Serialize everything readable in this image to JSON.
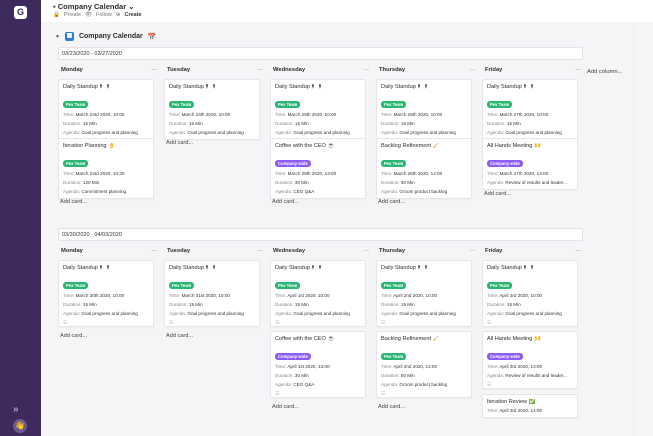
{
  "app": {
    "logo": "G",
    "title": "Company Calendar",
    "private": "Private",
    "follow": "Follow",
    "create": "Create",
    "expand": "»"
  },
  "board": {
    "title": "Company Calendar",
    "add_column": "Add column...",
    "add_card": "Add card..."
  },
  "weeks": [
    {
      "range": "03/23/2020 - 03/27/2020",
      "days": [
        {
          "name": "Monday",
          "cards": [
            {
              "title": "Daily Standup🕴🕴",
              "badge": "Pex Team",
              "badge_color": "green",
              "time": "March 23rd 2020, 10:00",
              "duration": "15 Min",
              "agenda": "Goal progress and planning"
            },
            {
              "title": "Iteration Planning 👌",
              "badge": "Pex Team",
              "badge_color": "green",
              "time": "March 23rd 2020, 10:30",
              "duration": "120 Min",
              "agenda": "Commitment planning"
            }
          ]
        },
        {
          "name": "Tuesday",
          "cards": [
            {
              "title": "Daily Standup🕴🕴",
              "badge": "Pex Team",
              "badge_color": "green",
              "time": "March 24th 2020, 10:00",
              "duration": "15 Min",
              "agenda": "Goal progress and planning"
            }
          ]
        },
        {
          "name": "Wednesday",
          "cards": [
            {
              "title": "Daily Standup🕴🕴",
              "badge": "Pex Team",
              "badge_color": "green",
              "time": "March 25th 2020, 10:00",
              "duration": "15 Min",
              "agenda": "Goal progress and planning"
            },
            {
              "title": "Coffee with the CEO ☕",
              "badge": "Company-wide",
              "badge_color": "purple",
              "time": "March 25th 2020, 13:00",
              "duration": "30 Min",
              "agenda": "CEO Q&A"
            }
          ]
        },
        {
          "name": "Thursday",
          "cards": [
            {
              "title": "Daily Standup🕴🕴",
              "badge": "Pex Team",
              "badge_color": "green",
              "time": "March 26th 2020, 10:00",
              "duration": "15 Min",
              "agenda": "Goal progress and planning"
            },
            {
              "title": "Backlog Refinement 🧹",
              "badge": "Pex Team",
              "badge_color": "green",
              "time": "March 26th 2020, 14:00",
              "duration": "60 Min",
              "agenda": "Groom product backlog"
            }
          ]
        },
        {
          "name": "Friday",
          "cards": [
            {
              "title": "Daily Standup🕴🕴",
              "badge": "Pex Team",
              "badge_color": "green",
              "time": "March 27th 2020, 10:00",
              "duration": "15 Min",
              "agenda": "Goal progress and planning"
            },
            {
              "title": "All Hands Meeting 🙌",
              "badge": "Company-wide",
              "badge_color": "purple",
              "time": "March 27th 2020, 13:00",
              "duration": "",
              "agenda": "Review of results and leader..."
            }
          ]
        }
      ]
    },
    {
      "range": "03/30/2020 - 04/03/2020",
      "days": [
        {
          "name": "Monday",
          "cards": [
            {
              "title": "Daily Standup🕴🕴",
              "badge": "Pex Team",
              "badge_color": "green",
              "time": "March 30th 2020, 10:00",
              "duration": "15 Min",
              "agenda": "Goal progress and planning"
            }
          ]
        },
        {
          "name": "Tuesday",
          "cards": [
            {
              "title": "Daily Standup🕴🕴",
              "badge": "Pex Team",
              "badge_color": "green",
              "time": "March 31st 2020, 10:00",
              "duration": "15 Min",
              "agenda": "Goal progress and planning"
            }
          ]
        },
        {
          "name": "Wednesday",
          "cards": [
            {
              "title": "Daily Standup🕴🕴",
              "badge": "Pex Team",
              "badge_color": "green",
              "time": "April 1st 2020, 10:00",
              "duration": "15 Min",
              "agenda": "Goal progress and planning"
            },
            {
              "title": "Coffee with the CEO ☕",
              "badge": "Company-wide",
              "badge_color": "purple",
              "time": "April 1st 2020, 13:00",
              "duration": "30 Min",
              "agenda": "CEO Q&A"
            }
          ]
        },
        {
          "name": "Thursday",
          "cards": [
            {
              "title": "Daily Standup🕴🕴",
              "badge": "Pex Team",
              "badge_color": "green",
              "time": "April 2nd 2020, 10:00",
              "duration": "15 Min",
              "agenda": "Goal progress and planning"
            },
            {
              "title": "Backlog Refinement 🧹",
              "badge": "Pex Team",
              "badge_color": "green",
              "time": "April 2nd 2020, 14:00",
              "duration": "60 Min",
              "agenda": "Groom product backlog"
            }
          ]
        },
        {
          "name": "Friday",
          "cards": [
            {
              "title": "Daily Standup🕴🕴",
              "badge": "Pex Team",
              "badge_color": "green",
              "time": "April 3rd 2020, 10:00",
              "duration": "15 Min",
              "agenda": "Goal progress and planning"
            },
            {
              "title": "All Hands Meeting 🙌",
              "badge": "Company-wide",
              "badge_color": "purple",
              "time": "April 3rd 2020, 13:00",
              "duration": "",
              "agenda": "Review of results and leader..."
            },
            {
              "title": "Iteration Review ✅",
              "badge": "",
              "badge_color": "",
              "time": "April 3rd 2020, 14:00",
              "duration": "",
              "agenda": ""
            }
          ]
        }
      ]
    }
  ],
  "labels": {
    "time": "Time:",
    "duration": "Duration:",
    "agenda": "Agenda:"
  },
  "colors": {
    "sidebar": "#3f2a5e",
    "badge_green": "#2bb673",
    "badge_purple": "#8b5cf6"
  }
}
